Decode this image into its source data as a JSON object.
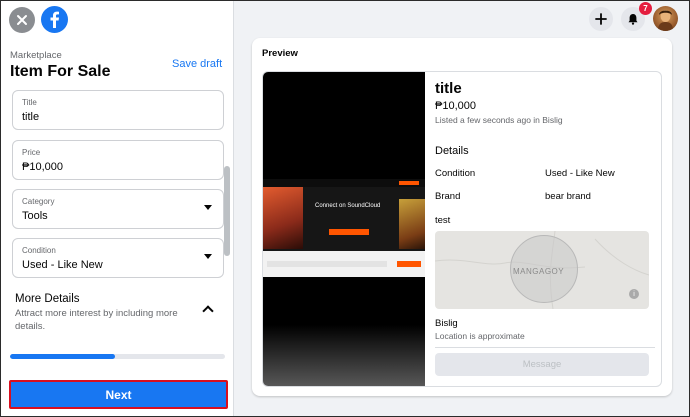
{
  "header": {
    "breadcrumb": "Marketplace",
    "title": "Item For Sale",
    "save_draft": "Save draft"
  },
  "form": {
    "title": {
      "label": "Title",
      "value": "title"
    },
    "price": {
      "label": "Price",
      "value": "₱10,000"
    },
    "category": {
      "label": "Category",
      "value": "Tools"
    },
    "condition": {
      "label": "Condition",
      "value": "Used - Like New"
    }
  },
  "more_details": {
    "title": "More Details",
    "description": "Attract more interest by including more details."
  },
  "progress_fraction": 0.49,
  "next_label": "Next",
  "notifications": {
    "count": "7"
  },
  "preview": {
    "label": "Preview",
    "listing_title": "title",
    "price": "₱10,000",
    "listed": "Listed a few seconds ago in Bislig",
    "details_heading": "Details",
    "rows": [
      {
        "key": "Condition",
        "value": "Used - Like New"
      },
      {
        "key": "Brand",
        "value": "bear brand"
      }
    ],
    "description": "test",
    "map_label": "MANGAGOY",
    "location": "Bislig",
    "location_note": "Location is approximate",
    "message_label": "Message",
    "screenshot_headline": "Connect on SoundCloud"
  },
  "icons": {
    "close": "close-icon",
    "logo": "facebook-logo-icon",
    "plus": "plus-icon",
    "bell": "bell-icon",
    "caret": "caret-down-icon",
    "chevron": "chevron-up-icon",
    "info": "info-icon"
  },
  "colors": {
    "brand": "#1877f2",
    "badge": "#e41e3f",
    "highlight": "#d90f1f"
  }
}
